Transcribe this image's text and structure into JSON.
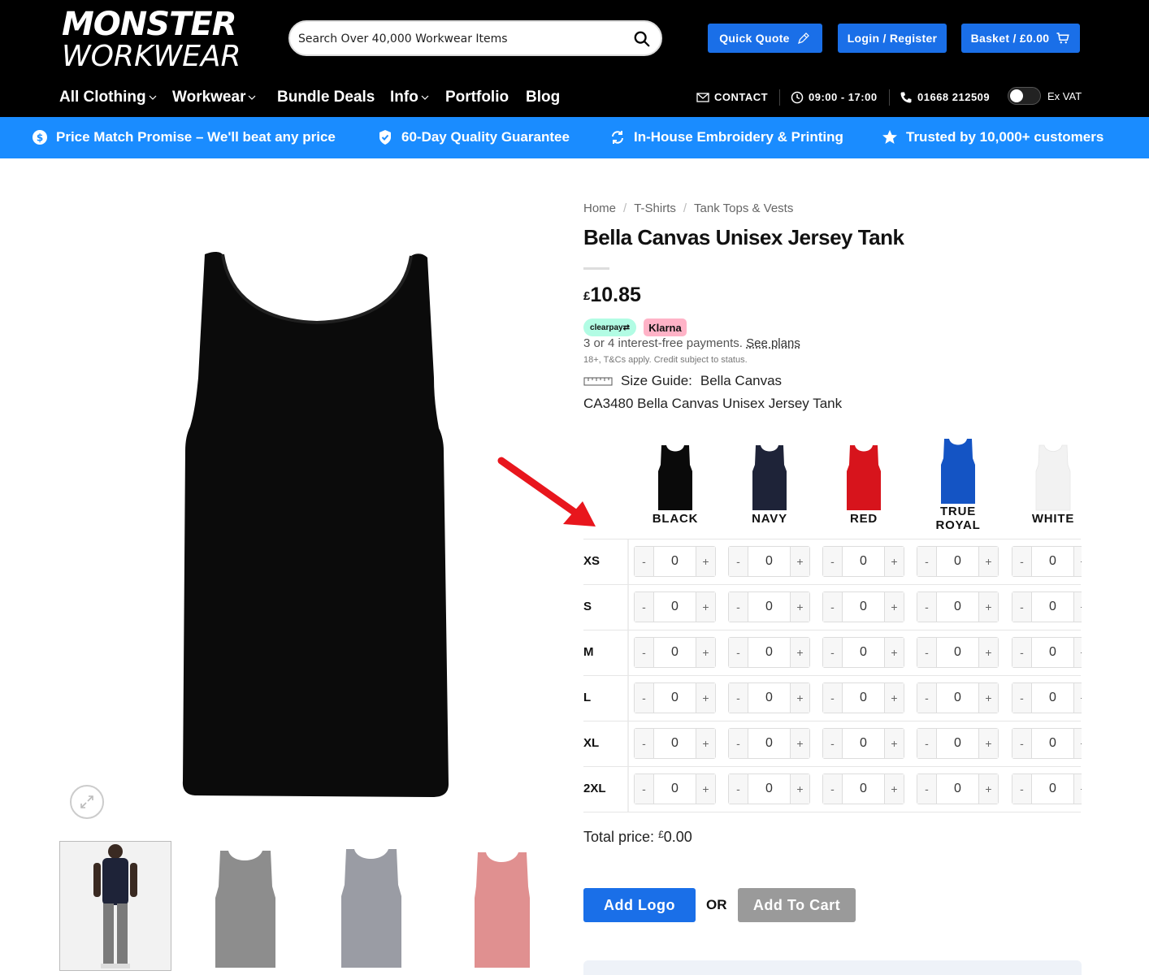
{
  "header": {
    "logo_top": "MONSTER",
    "logo_bottom": "WORKWEAR",
    "search_placeholder": "Search Over 40,000 Workwear Items",
    "quick_quote": "Quick Quote",
    "login": "Login / Register",
    "basket": "Basket / £0.00"
  },
  "nav": {
    "items": [
      {
        "label": "All Clothing"
      },
      {
        "label": "Workwear"
      },
      {
        "label": "Bundle Deals"
      },
      {
        "label": "Info"
      },
      {
        "label": "Portfolio"
      },
      {
        "label": "Blog"
      }
    ],
    "contact": "CONTACT",
    "hours": "09:00 - 17:00",
    "phone": "01668 212509",
    "vat_label": "Ex VAT"
  },
  "promos": [
    {
      "label": "Price Match Promise – We'll beat any price",
      "icon": "dollar-circle-icon"
    },
    {
      "label": "60-Day Quality Guarantee",
      "icon": "shield-check-icon"
    },
    {
      "label": "In-House Embroidery & Printing",
      "icon": "refresh-icon"
    },
    {
      "label": "Trusted by 10,000+ customers",
      "icon": "star-icon"
    }
  ],
  "breadcrumb": [
    "Home",
    "T-Shirts",
    "Tank Tops & Vests"
  ],
  "product": {
    "title": "Bella Canvas Unisex Jersey Tank",
    "currency": "£",
    "price": "10.85",
    "clearpay_label": "clearpay⇄",
    "klarna_label": "Klarna",
    "payments_text": "3 or 4 interest-free payments.",
    "see_plans": "See plans",
    "terms": "18+, T&Cs apply. Credit subject to status.",
    "size_guide_label": "Size Guide:",
    "size_guide_brand": "Bella Canvas",
    "code_line": "CA3480 Bella Canvas Unisex Jersey Tank"
  },
  "colours": [
    {
      "name": "BLACK",
      "hex": "#0a0a0a"
    },
    {
      "name": "NAVY",
      "hex": "#1e2338"
    },
    {
      "name": "RED",
      "hex": "#d7141c"
    },
    {
      "name": "TRUE ROYAL",
      "hex": "#1454c4"
    },
    {
      "name": "WHITE",
      "hex": "#f2f2f2"
    }
  ],
  "sizes": [
    "XS",
    "S",
    "M",
    "L",
    "XL",
    "2XL"
  ],
  "stepper": {
    "minus": "-",
    "plus": "+",
    "value": "0"
  },
  "total": {
    "label": "Total price:",
    "currency": "£",
    "value": "0.00"
  },
  "buttons": {
    "add_logo": "Add Logo",
    "or": "OR",
    "add_to_cart": "Add To Cart"
  },
  "thumbnails": [
    {
      "name": "model-navy",
      "colour": "#1e2338"
    },
    {
      "name": "grey-tank",
      "colour": "#8d8d8d"
    },
    {
      "name": "athletic-grey-tank",
      "colour": "#9a9ca4"
    },
    {
      "name": "pink-tank",
      "colour": "#e09090"
    }
  ]
}
